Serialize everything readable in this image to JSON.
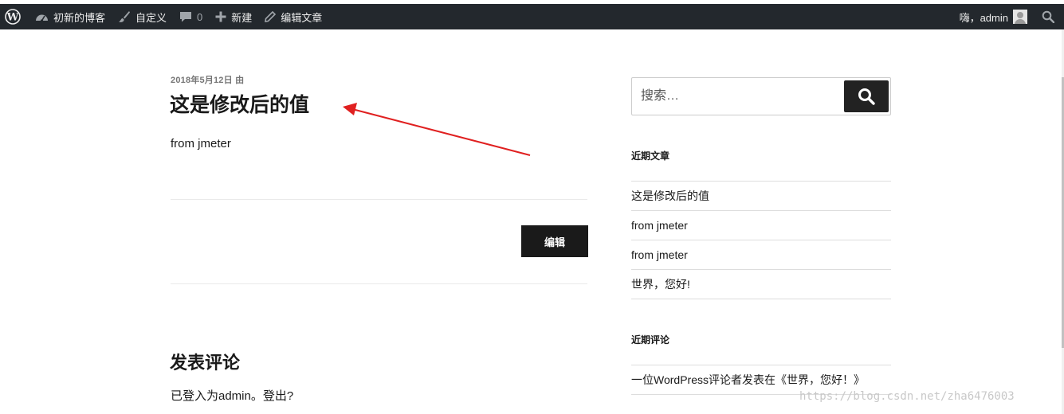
{
  "admin_bar": {
    "site_name": "初新的博客",
    "customize": "自定义",
    "comments_count": "0",
    "new": "新建",
    "edit_post": "编辑文章",
    "greeting": "嗨，admin",
    "icons": {
      "wp": "wordpress-logo-icon",
      "site": "dashboard-gauge-icon",
      "customize": "paintbrush-icon",
      "comments": "speech-bubble-icon",
      "new": "plus-icon",
      "edit": "pencil-icon",
      "search": "search-icon"
    },
    "bg_color": "#23282d"
  },
  "post": {
    "meta": "2018年5月12日 由",
    "title": "这是修改后的值",
    "content": "from jmeter",
    "edit_label": "编辑"
  },
  "comments": {
    "title": "发表评论",
    "logged_in": "已登入为admin。登出?"
  },
  "sidebar": {
    "search_placeholder": "搜索…",
    "recent_posts_title": "近期文章",
    "recent_posts": [
      "这是修改后的值",
      "from jmeter",
      "from jmeter",
      "世界，您好!"
    ],
    "recent_comments_title": "近期评论",
    "recent_comments": [
      "一位WordPress评论者发表在《世界，您好！》"
    ]
  },
  "watermark": "https://blog.csdn.net/zha6476003",
  "annotation_color": "#e02020"
}
